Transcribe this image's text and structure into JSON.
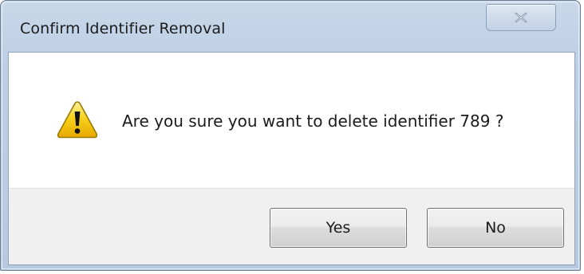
{
  "dialog": {
    "title": "Confirm Identifier Removal",
    "message": "Are you sure you want to delete identifier 789 ?",
    "icon": "warning-icon",
    "buttons": {
      "yes_label": "Yes",
      "no_label": "No"
    },
    "close_icon": "close-icon"
  },
  "colors": {
    "titlebar": "#bfd0e6",
    "content_bg": "#ffffff",
    "button_area_bg": "#f0f0f0",
    "warning_fill": "#f5c400"
  }
}
